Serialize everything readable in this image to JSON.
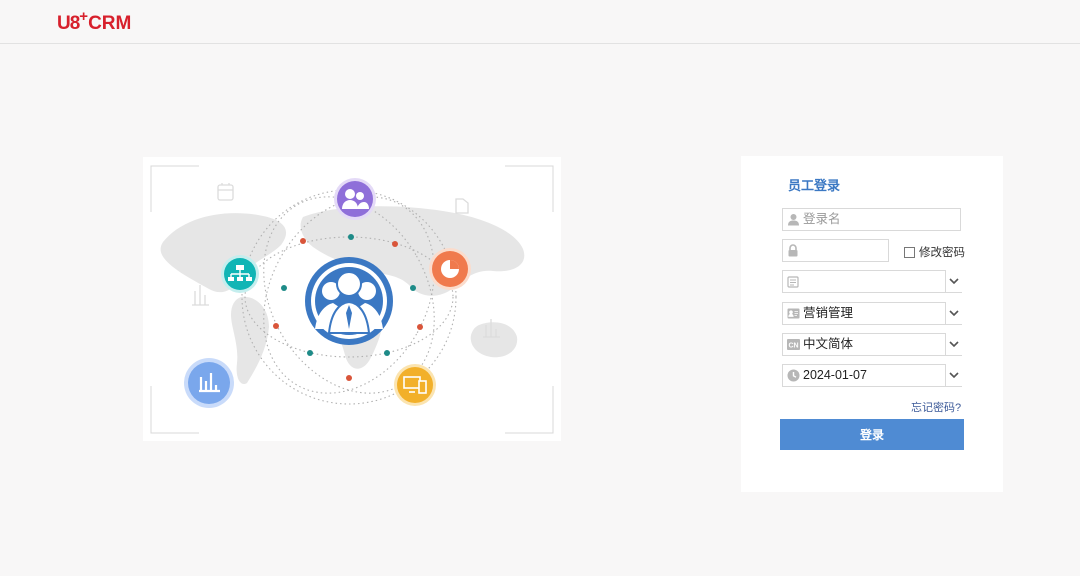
{
  "header": {
    "logo_u8": "U8",
    "logo_plus": "+",
    "logo_crm": "CRM"
  },
  "login": {
    "title": "员工登录",
    "username_placeholder": "登录名",
    "password_value": "",
    "change_password_label": "修改密码",
    "account_value": "",
    "module_value": "营销管理",
    "language_value": "中文简体",
    "date_value": "2024-01-07",
    "forgot_label": "忘记密码?",
    "login_label": "登录"
  },
  "colors": {
    "brand": "#d7202c",
    "primary": "#4f8bd3",
    "title": "#3b78c3",
    "purple": "#8f6fd9",
    "teal": "#11b5b5",
    "orange": "#f07a4d",
    "yellow": "#f2b02a",
    "blue": "#7aa7ec"
  },
  "icons": {
    "username": "user-icon",
    "password": "lock-icon",
    "account": "database-icon",
    "module": "id-card-icon",
    "language": "cn-icon",
    "date": "clock-icon",
    "dropdown": "chevron-down-icon"
  }
}
